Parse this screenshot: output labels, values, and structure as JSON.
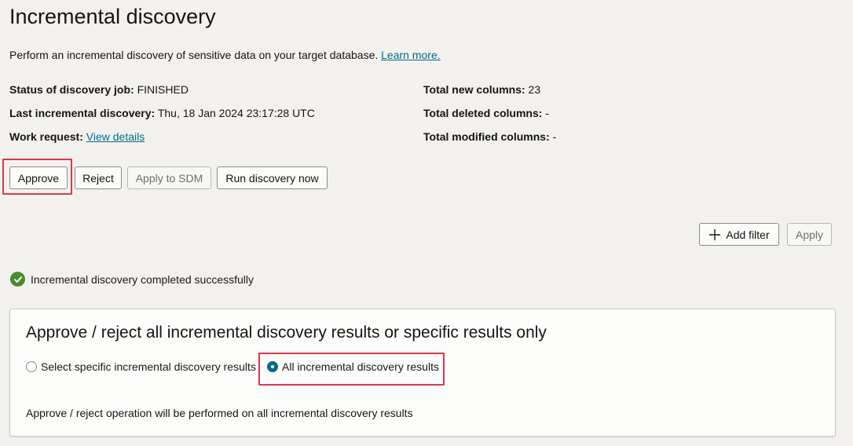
{
  "page": {
    "title": "Incremental discovery",
    "intro_text": "Perform an incremental discovery of sensitive data on your target database.",
    "learn_more": "Learn more."
  },
  "details": {
    "status_label": "Status of discovery job:",
    "status_value": "FINISHED",
    "last_label": "Last incremental discovery:",
    "last_value": "Thu, 18 Jan 2024 23:17:28 UTC",
    "work_label": "Work request:",
    "work_link": "View details",
    "new_cols_label": "Total new columns:",
    "new_cols_value": "23",
    "deleted_cols_label": "Total deleted columns:",
    "deleted_cols_value": "-",
    "modified_cols_label": "Total modified columns:",
    "modified_cols_value": "-"
  },
  "actions": {
    "approve": "Approve",
    "reject": "Reject",
    "apply_sdm": "Apply to SDM",
    "run_now": "Run discovery now"
  },
  "filters": {
    "add_filter": "Add filter",
    "apply": "Apply"
  },
  "status_message": "Incremental discovery completed successfully",
  "card": {
    "title": "Approve / reject all incremental discovery results or specific results only",
    "option_specific": "Select specific incremental discovery results",
    "option_all": "All incremental discovery results",
    "selected_option": "All incremental discovery results",
    "note": "Approve / reject operation will be performed on all incremental discovery results"
  },
  "colors": {
    "highlight": "#d9394b",
    "link": "#006b8f",
    "success": "#4c8a2e",
    "radio_selected": "#046b83"
  }
}
